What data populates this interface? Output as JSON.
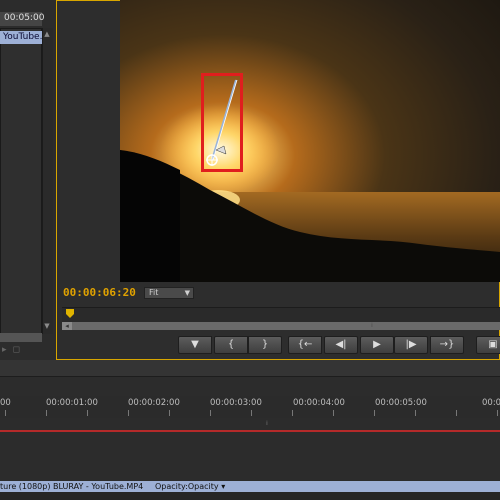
{
  "colors": {
    "accent_timecode": "#e0a200",
    "selection_blue": "#9db0d6",
    "highlight_red": "#e01e1e",
    "panel_border_active": "#d8a600"
  },
  "project_panel": {
    "timecode": "00:05:00",
    "selected_item": "YouTube."
  },
  "monitor": {
    "current_timecode": "00:00:06:20",
    "zoom_select": "Fit",
    "transport": [
      {
        "name": "add-marker-button",
        "glyph": "▼"
      },
      {
        "name": "mark-in-button",
        "glyph": "{"
      },
      {
        "name": "mark-out-button",
        "glyph": "}"
      },
      {
        "name": "go-to-in-button",
        "glyph": "{←"
      },
      {
        "name": "step-back-button",
        "glyph": "◀|"
      },
      {
        "name": "play-button",
        "glyph": "▶"
      },
      {
        "name": "step-forward-button",
        "glyph": "|▶"
      },
      {
        "name": "go-to-out-button",
        "glyph": "→}"
      },
      {
        "name": "export-frame-button",
        "glyph": "▣"
      }
    ]
  },
  "timeline": {
    "ruler_labels": [
      "00",
      "00:00:01:00",
      "00:00:02:00",
      "00:00:03:00",
      "00:00:04:00",
      "00:00:05:00",
      "00:0"
    ],
    "clip_name": "ture (1080p) BLURAY - YouTube.MP4",
    "clip_opacity_menu": "Opacity:Opacity ▾"
  },
  "icons": {
    "pen_tool": "pen-tool-icon",
    "playhead": "playhead-icon"
  }
}
